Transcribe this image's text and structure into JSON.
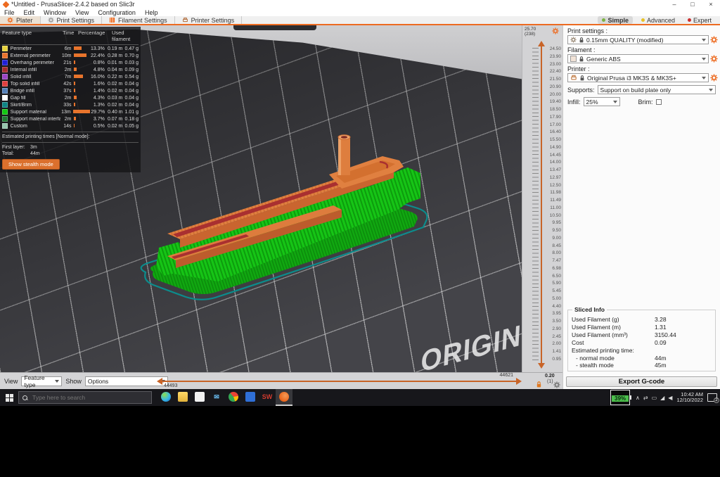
{
  "window": {
    "title": "*Untitled - PrusaSlicer-2.4.2 based on Slic3r",
    "controls": {
      "minimize": "–",
      "maximize": "□",
      "close": "×"
    }
  },
  "menu": {
    "items": [
      "File",
      "Edit",
      "Window",
      "View",
      "Configuration",
      "Help"
    ]
  },
  "tabs": [
    {
      "label": "Plater",
      "selected": true
    },
    {
      "label": "Print Settings"
    },
    {
      "label": "Filament Settings"
    },
    {
      "label": "Printer Settings"
    }
  ],
  "modes": [
    {
      "label": "Simple",
      "dot": "#7cb342",
      "bg": "#d9d9d9",
      "weight": "bold"
    },
    {
      "label": "Advanced",
      "dot": "#e8c227",
      "bg": "transparent",
      "weight": "normal"
    },
    {
      "label": "Expert",
      "dot": "#cc2f2f",
      "bg": "transparent",
      "weight": "normal"
    }
  ],
  "legend": {
    "headers": {
      "feature": "Feature type",
      "time": "Time",
      "percentage": "Percentage",
      "used": "Used filament"
    },
    "rows": [
      {
        "name": "Perimeter",
        "color": "#e6d23c",
        "time": "6m",
        "bar": "11px",
        "pct": "13.3%",
        "len": "0.19 m",
        "wt": "0.47 g"
      },
      {
        "name": "External perimeter",
        "color": "#e8732c",
        "time": "10m",
        "bar": "18px",
        "pct": "22.4%",
        "len": "0.28 m",
        "wt": "0.70 g"
      },
      {
        "name": "Overhang perimeter",
        "color": "#1f1fd8",
        "time": "21s",
        "bar": "2px",
        "pct": "0.8%",
        "len": "0.01 m",
        "wt": "0.03 g"
      },
      {
        "name": "Internal infill",
        "color": "#a62b2b",
        "time": "2m",
        "bar": "4px",
        "pct": "4.8%",
        "len": "0.04 m",
        "wt": "0.09 g"
      },
      {
        "name": "Solid infill",
        "color": "#9a43c4",
        "time": "7m",
        "bar": "13px",
        "pct": "16.0%",
        "len": "0.22 m",
        "wt": "0.54 g"
      },
      {
        "name": "Top solid infill",
        "color": "#e03e3e",
        "time": "42s",
        "bar": "2px",
        "pct": "1.6%",
        "len": "0.02 m",
        "wt": "0.04 g"
      },
      {
        "name": "Bridge infill",
        "color": "#5480b8",
        "time": "37s",
        "bar": "2px",
        "pct": "1.4%",
        "len": "0.02 m",
        "wt": "0.04 g"
      },
      {
        "name": "Gap fill",
        "color": "#ffffff",
        "time": "2m",
        "bar": "4px",
        "pct": "4.3%",
        "len": "0.03 m",
        "wt": "0.04 g"
      },
      {
        "name": "Skirt/Brim",
        "color": "#0e8585",
        "time": "33s",
        "bar": "2px",
        "pct": "1.3%",
        "len": "0.02 m",
        "wt": "0.04 g"
      },
      {
        "name": "Support material",
        "color": "#12c812",
        "time": "13m",
        "bar": "24px",
        "pct": "29.7%",
        "len": "0.40 m",
        "wt": "1.01 g"
      },
      {
        "name": "Support material interface",
        "color": "#1e7a32",
        "time": "2m",
        "bar": "3px",
        "pct": "3.7%",
        "len": "0.07 m",
        "wt": "0.18 g"
      },
      {
        "name": "Custom",
        "color": "#94c4ac",
        "time": "14s",
        "bar": "1px",
        "pct": "0.5%",
        "len": "0.02 m",
        "wt": "0.05 g"
      }
    ],
    "times_title": "Estimated printing times [Normal mode]:",
    "first_layer_label": "First layer:",
    "first_layer": "3m",
    "total_label": "Total:",
    "total": "44m",
    "stealth_button": "Show stealth mode"
  },
  "viewport": {
    "plate_text": "ORIGIN"
  },
  "layer_slider": {
    "top_value": "25.70",
    "top_layer": "(238)",
    "bottom_value": "0.20",
    "bottom_layer": "(1)",
    "ticks": [
      "24.50",
      "23.90",
      "23.00",
      "22.40",
      "21.50",
      "20.90",
      "20.00",
      "19.40",
      "18.50",
      "17.90",
      "17.00",
      "16.40",
      "15.50",
      "14.90",
      "14.45",
      "14.00",
      "13.47",
      "12.97",
      "12.50",
      "11.98",
      "11.49",
      "11.00",
      "10.50",
      "9.95",
      "9.50",
      "9.00",
      "8.45",
      "8.00",
      "7.47",
      "6.98",
      "6.50",
      "5.90",
      "5.45",
      "5.00",
      "4.40",
      "3.95",
      "3.50",
      "2.90",
      "2.45",
      "2.00",
      "1.41",
      "0.95"
    ]
  },
  "view_bar": {
    "view_label": "View",
    "view_value": "Feature type",
    "show_label": "Show",
    "show_value": "Options",
    "move_max": "44621",
    "move_min": "44493"
  },
  "sidebar": {
    "print_settings": {
      "label": "Print settings :",
      "value": "0.15mm QUALITY (modified)"
    },
    "filament": {
      "label": "Filament :",
      "value": "Generic ABS",
      "swatch": "#f2e3d7"
    },
    "printer": {
      "label": "Printer :",
      "value": "Original Prusa i3 MK3S & MK3S+"
    },
    "supports": {
      "label": "Supports:",
      "value": "Support on build plate only"
    },
    "infill": {
      "label": "Infill:",
      "value": "25%"
    },
    "brim": {
      "label": "Brim:"
    },
    "sliced_info": {
      "title": "Sliced Info",
      "rows": [
        {
          "label": "Used Filament (g)",
          "value": "3.28"
        },
        {
          "label": "Used Filament (m)",
          "value": "1.31"
        },
        {
          "label": "Used Filament (mm³)",
          "value": "3150.44"
        },
        {
          "label": "Cost",
          "value": "0.09"
        }
      ],
      "time_title": "Estimated printing time:",
      "time_rows": [
        {
          "label": "- normal mode",
          "value": "44m"
        },
        {
          "label": "- stealth mode",
          "value": "45m"
        }
      ]
    },
    "export_button": "Export G-code"
  },
  "taskbar": {
    "search_placeholder": "Type here to search",
    "apps": [
      {
        "name": "edge-icon",
        "bg": "radial-gradient(circle at 35% 30%, #8ede4c, #35b7e8 55%, #1e63b4)",
        "radius": "50%"
      },
      {
        "name": "file-explorer-icon",
        "bg": "linear-gradient(#ffd968, #e2b23a)",
        "radius": "2px"
      },
      {
        "name": "microsoft-store-icon",
        "bg": "#f2f2f2",
        "radius": "2px"
      },
      {
        "name": "mail-icon",
        "bg": "transparent",
        "radius": "0",
        "glyph": "✉",
        "color": "#6cc0f5"
      },
      {
        "name": "chrome-icon",
        "bg": "conic-gradient(from -40deg, #ea4335 0 120deg, #fbbc05 0 200deg, #34a853 0 360deg)",
        "radius": "50%"
      },
      {
        "name": "blue-grid-app-icon",
        "bg": "#2f6fd6",
        "radius": "2px"
      },
      {
        "name": "solidworks-icon",
        "bg": "transparent",
        "radius": "0",
        "glyph": "SW",
        "color": "#d23b2f"
      },
      {
        "name": "prusaslicer-icon",
        "bg": "radial-gradient(circle at 62% 38%, #f59a56, #ed6b21 60%, #b84a10)",
        "radius": "50%",
        "tile": "rgba(255,255,255,0.14)",
        "underline": "#cfcfcf"
      }
    ],
    "tray": [
      {
        "name": "tray-expand-icon",
        "glyph": "∧"
      },
      {
        "name": "sync-icon",
        "glyph": "⇄"
      },
      {
        "name": "battery-icon",
        "glyph": "▭"
      },
      {
        "name": "wifi-icon",
        "glyph": "◢"
      },
      {
        "name": "volume-icon",
        "glyph": "◀"
      }
    ],
    "battery": "39%",
    "time": "10:42 AM",
    "date": "12/10/2022",
    "badge": "2"
  }
}
